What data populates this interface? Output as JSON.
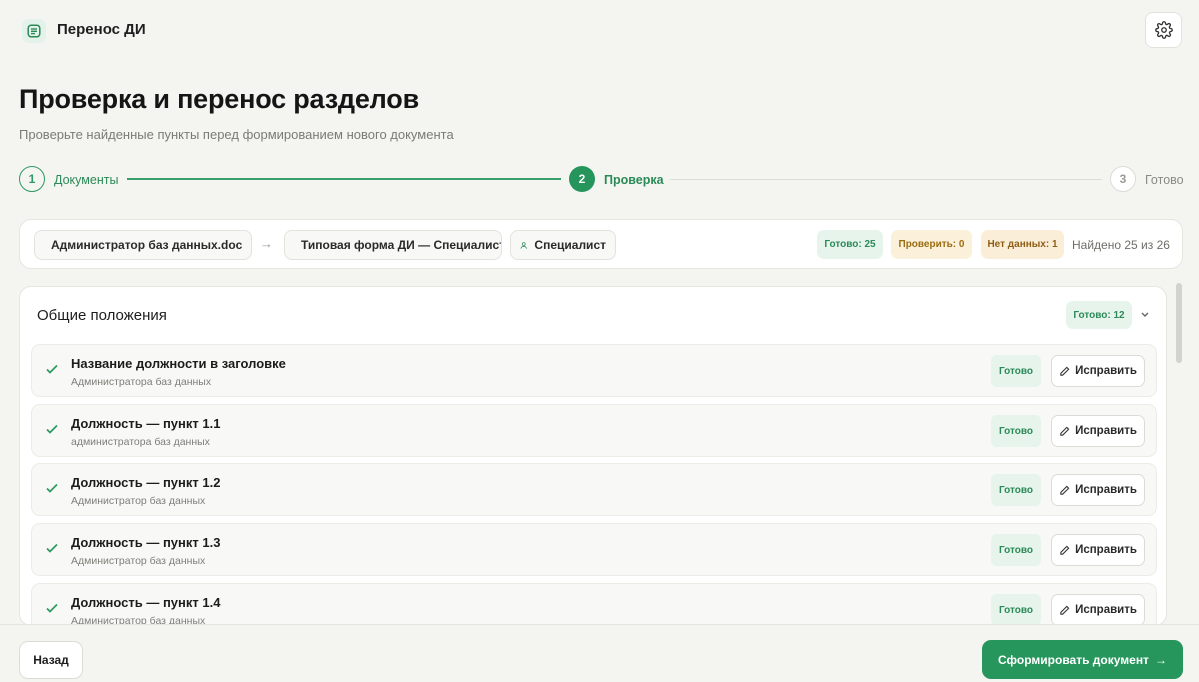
{
  "app": {
    "title": "Перенос ДИ"
  },
  "header": {
    "title": "Проверка и перенос разделов",
    "subtitle": "Проверьте найденные пункты перед формированием нового документа"
  },
  "stepper": {
    "steps": [
      {
        "number": "1",
        "label": "Документы",
        "state": "done"
      },
      {
        "number": "2",
        "label": "Проверка",
        "state": "active"
      },
      {
        "number": "3",
        "label": "Готово",
        "state": "todo"
      }
    ]
  },
  "summary": {
    "source_doc": "Администратор баз данных.doc",
    "template_doc": "Типовая форма ДИ — Специалист",
    "role": "Специалист",
    "badges": {
      "ready": "Готово: 25",
      "check": "Проверить: 0",
      "no_data": "Нет данных: 1"
    },
    "found": "Найдено 25 из 26"
  },
  "section": {
    "title": "Общие положения",
    "badge": "Готово: 12",
    "rows": [
      {
        "title": "Название должности в заголовке",
        "subtitle": "Администратора баз данных",
        "status": "Готово",
        "action": "Исправить"
      },
      {
        "title": "Должность — пункт 1.1",
        "subtitle": "администратора баз данных",
        "status": "Готово",
        "action": "Исправить"
      },
      {
        "title": "Должность — пункт 1.2",
        "subtitle": "Администратор баз данных",
        "status": "Готово",
        "action": "Исправить"
      },
      {
        "title": "Должность — пункт 1.3",
        "subtitle": "Администратор баз данных",
        "status": "Готово",
        "action": "Исправить"
      },
      {
        "title": "Должность — пункт 1.4",
        "subtitle": "Администратор баз данных",
        "status": "Готово",
        "action": "Исправить"
      }
    ]
  },
  "footer": {
    "back_label": "Назад",
    "primary_label": "Сформировать документ",
    "primary_arrow": "→"
  },
  "colors": {
    "accent": "#27965d",
    "ready_bg": "#e6f4ec",
    "check_bg": "#fbf0d9",
    "background": "#f4f4f1"
  },
  "icons": {
    "logo": "document-list-icon",
    "settings": "gear-icon",
    "file": "file-icon",
    "user": "user-icon",
    "check": "check-icon",
    "edit": "pencil-icon",
    "collapse": "chevron-down-icon",
    "arrow": "arrow-right-icon"
  }
}
